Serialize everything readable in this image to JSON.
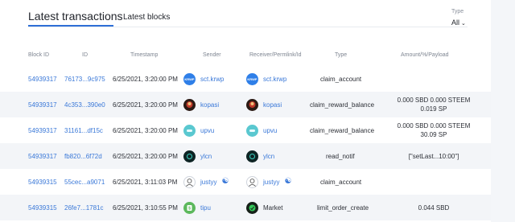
{
  "tabs": [
    {
      "label": "Latest transactions",
      "active": true
    },
    {
      "label": "Latest blocks",
      "active": false
    }
  ],
  "filter": {
    "label": "Type",
    "value": "All"
  },
  "columns": [
    "Block ID",
    "ID",
    "Timestamp",
    "Sender",
    "Receiver/Permlink/Id",
    "Type",
    "Amount/%/Payload"
  ],
  "rows": [
    {
      "block": "54939317",
      "id": "76173...9c975",
      "time": "6/25/2021, 3:20:00 PM",
      "sender": "sct.krwp",
      "sender_avatar": "krwp-logo-icon",
      "receiver": "sct.krwp",
      "receiver_avatar": "krwp-logo-icon",
      "type": "claim_account",
      "payload": ""
    },
    {
      "block": "54939317",
      "id": "4c353...390e0",
      "time": "6/25/2021, 3:20:00 PM",
      "sender": "kopasi",
      "sender_avatar": "kopasi-avatar-icon",
      "receiver": "kopasi",
      "receiver_avatar": "kopasi-avatar-icon",
      "type": "claim_reward_balance",
      "payload": "0.000 SBD 0.000 STEEM 0.019 SP"
    },
    {
      "block": "54939317",
      "id": "31161...df15c",
      "time": "6/25/2021, 3:20:00 PM",
      "sender": "upvu",
      "sender_avatar": "upvu-avatar-icon",
      "receiver": "upvu",
      "receiver_avatar": "upvu-avatar-icon",
      "type": "claim_reward_balance",
      "payload": "0.000 SBD 0.000 STEEM 30.09 SP"
    },
    {
      "block": "54939317",
      "id": "fb820...6f72d",
      "time": "6/25/2021, 3:20:00 PM",
      "sender": "ylcn",
      "sender_avatar": "ylcn-avatar-icon",
      "receiver": "ylcn",
      "receiver_avatar": "ylcn-avatar-icon",
      "type": "read_notif",
      "payload": "[\"setLast...10:00\"]"
    },
    {
      "block": "54939315",
      "id": "55cec...a9071",
      "time": "6/25/2021, 3:11:03 PM",
      "sender": "justyy",
      "sender_avatar": "justyy-avatar-icon",
      "sender_badge": "human-icon",
      "receiver": "justyy",
      "receiver_avatar": "justyy-avatar-icon",
      "receiver_badge": "human-icon",
      "type": "claim_account",
      "payload": ""
    },
    {
      "block": "54939315",
      "id": "26fe7...1781c",
      "time": "6/25/2021, 3:10:55 PM",
      "sender": "tipu",
      "sender_avatar": "tipu-avatar-icon",
      "receiver": "Market",
      "receiver_avatar": "market-icon",
      "type": "limit_order_create",
      "payload": "0.044 SBD"
    }
  ],
  "colors": {
    "accent": "#2f6fd6",
    "link": "#3a78d8",
    "row_alt": "#f3f5f8"
  }
}
